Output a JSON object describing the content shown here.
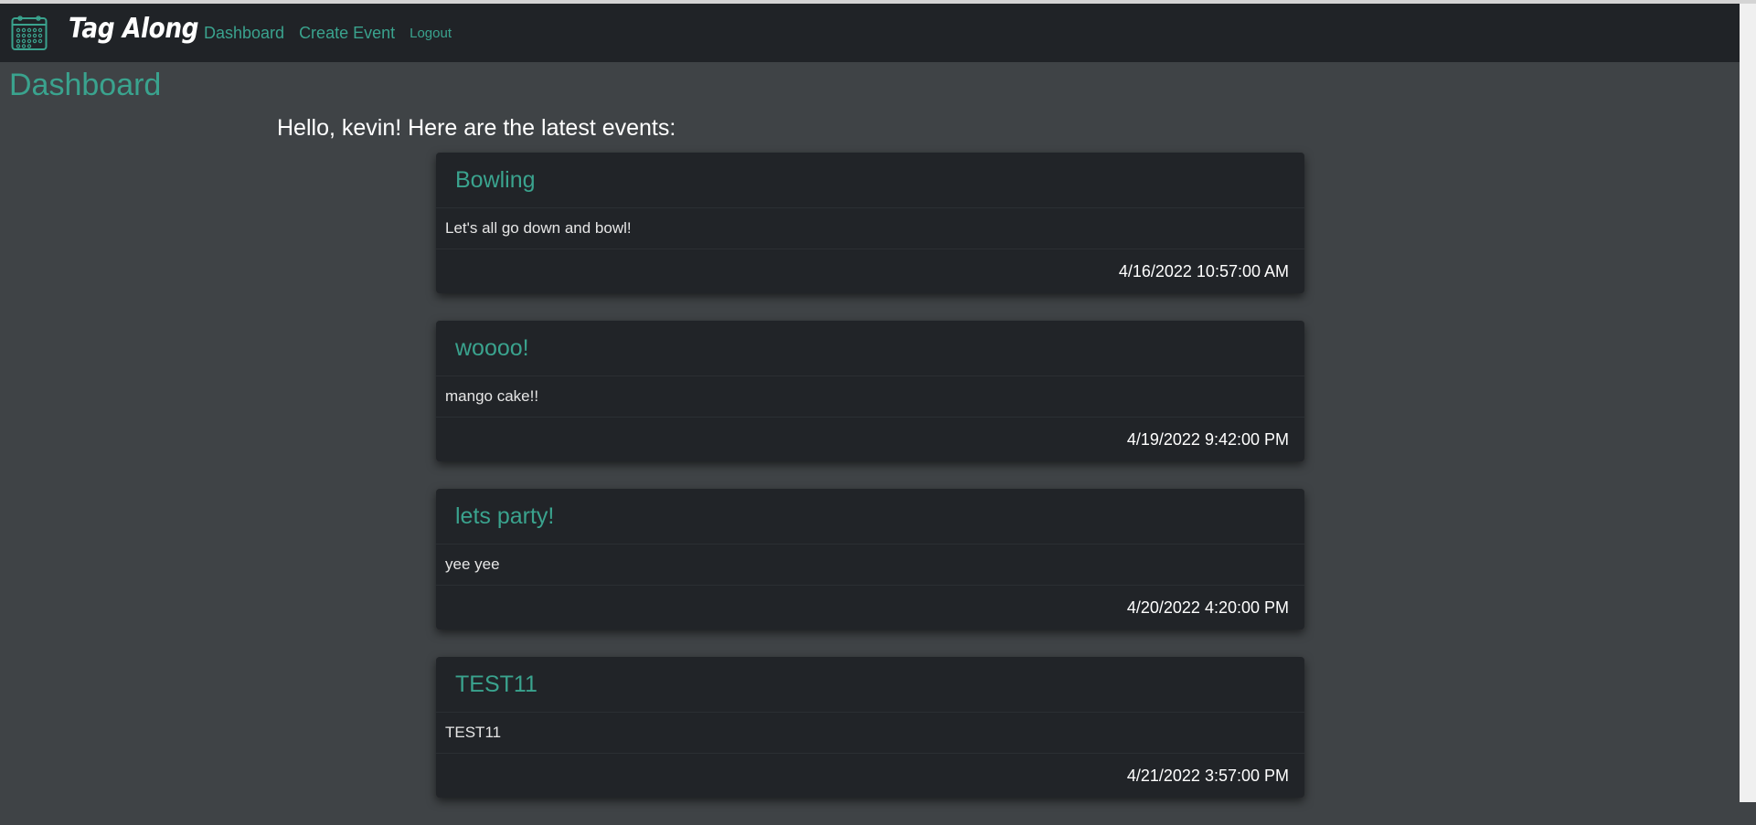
{
  "nav": {
    "brand": "Tag Along",
    "links": [
      {
        "label": "Dashboard"
      },
      {
        "label": "Create Event"
      },
      {
        "label": "Logout"
      }
    ]
  },
  "page": {
    "title": "Dashboard",
    "greeting": "Hello, kevin! Here are the latest events:"
  },
  "events": [
    {
      "title": "Bowling",
      "description": "Let's all go down and bowl!",
      "date": "4/16/2022 10:57:00 AM"
    },
    {
      "title": "woooo!",
      "description": "mango cake!!",
      "date": "4/19/2022 9:42:00 PM"
    },
    {
      "title": "lets party!",
      "description": "yee yee",
      "date": "4/20/2022 4:20:00 PM"
    },
    {
      "title": "TEST11",
      "description": "TEST11",
      "date": "4/21/2022 3:57:00 PM"
    }
  ],
  "colors": {
    "accent": "#3aa38e",
    "navbar": "#202327",
    "background": "#3f4346",
    "card": "#212428"
  },
  "icons": {
    "logo": "calendar-icon"
  }
}
